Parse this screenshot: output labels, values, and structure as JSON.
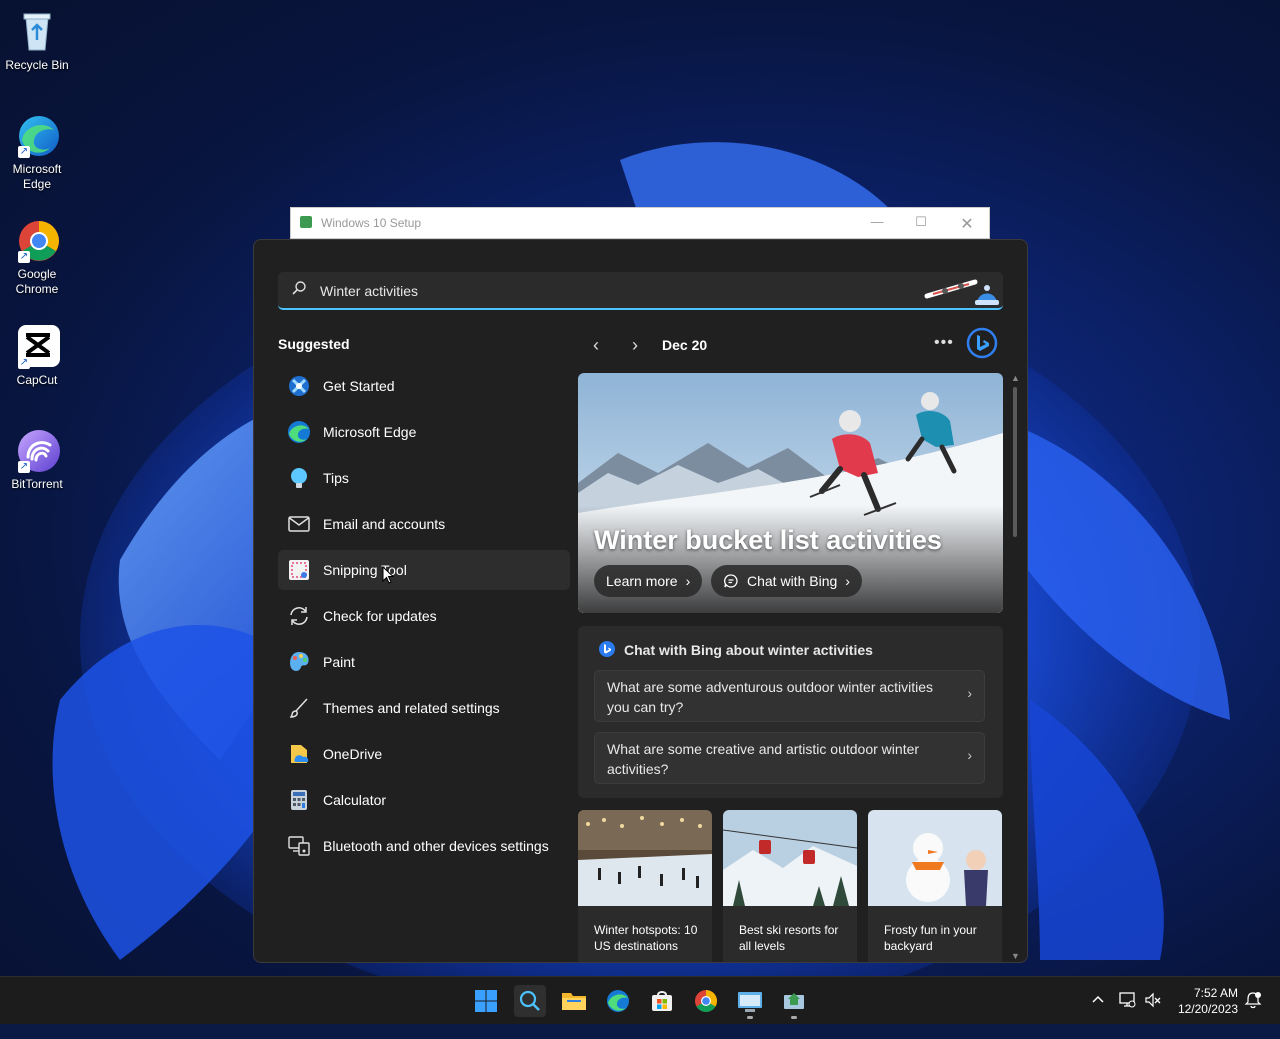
{
  "desktop": {
    "icons": [
      {
        "label": "Recycle Bin"
      },
      {
        "label": "Microsoft Edge"
      },
      {
        "label": "Google Chrome"
      },
      {
        "label": "CapCut"
      },
      {
        "label": "BitTorrent"
      }
    ]
  },
  "setup_window": {
    "title": "Windows 10 Setup"
  },
  "search": {
    "query": "Winter activities",
    "suggested_title": "Suggested",
    "suggested": [
      {
        "label": "Get Started",
        "icon": "get-started-icon"
      },
      {
        "label": "Microsoft Edge",
        "icon": "edge-icon"
      },
      {
        "label": "Tips",
        "icon": "tips-icon"
      },
      {
        "label": "Email and accounts",
        "icon": "mail-icon"
      },
      {
        "label": "Snipping Tool",
        "icon": "snipping-tool-icon"
      },
      {
        "label": "Check for updates",
        "icon": "refresh-icon"
      },
      {
        "label": "Paint",
        "icon": "paint-icon"
      },
      {
        "label": "Themes and related settings",
        "icon": "brush-icon"
      },
      {
        "label": "OneDrive",
        "icon": "onedrive-icon"
      },
      {
        "label": "Calculator",
        "icon": "calculator-icon"
      },
      {
        "label": "Bluetooth and other devices settings",
        "icon": "devices-icon"
      }
    ],
    "date": "Dec 20",
    "hero": {
      "title": "Winter bucket list activities",
      "learn_more": "Learn more",
      "chat_with_bing": "Chat with Bing"
    },
    "chat": {
      "title": "Chat with Bing about winter activities",
      "questions": [
        "What are some adventurous outdoor winter activities you can try?",
        "What are some creative and artistic outdoor winter activities?"
      ]
    },
    "tiles": [
      {
        "caption": "Winter hotspots: 10 US destinations"
      },
      {
        "caption": "Best ski resorts for all levels"
      },
      {
        "caption": "Frosty fun in your backyard"
      }
    ]
  },
  "taskbar": {
    "time": "7:52 AM",
    "date": "12/20/2023"
  },
  "colors": {
    "accent": "#4cc2ff",
    "panel_bg": "#202020",
    "card_bg": "#2b2b2b",
    "taskbar_bg": "#1c1c1c"
  }
}
